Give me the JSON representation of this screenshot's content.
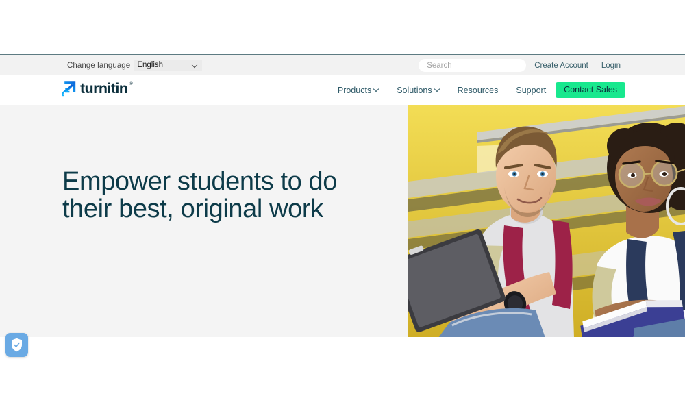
{
  "brand": {
    "name": "turnitin",
    "trademark": "®",
    "logo_icon": "turnitin-arrow-mark",
    "green": "#18e88e",
    "navy": "#0c2f3c",
    "teal": "#0d3b49"
  },
  "utility_bar": {
    "language_label": "Change language",
    "language_selected": "English",
    "language_options": [
      "English"
    ],
    "chevron_icon": "chevron-down-icon",
    "search": {
      "placeholder": "Search",
      "value": "",
      "icon": "search-input"
    },
    "create_account": "Create Account",
    "login": "Login"
  },
  "nav": {
    "items": [
      {
        "label": "Products",
        "has_dropdown": true
      },
      {
        "label": "Solutions",
        "has_dropdown": true
      },
      {
        "label": "Resources",
        "has_dropdown": false
      },
      {
        "label": "Support",
        "has_dropdown": false
      }
    ],
    "cta_label": "Contact Sales"
  },
  "hero": {
    "title_line1": "Empower students to do",
    "title_line2": "their best, original work",
    "background": "#f4f4f4",
    "image_alt": "Two students sitting on yellow stairs, one holding a tablet and one with an open book"
  },
  "privacy_badge": {
    "icon": "shield-check-icon",
    "color": "#6aaae4"
  }
}
